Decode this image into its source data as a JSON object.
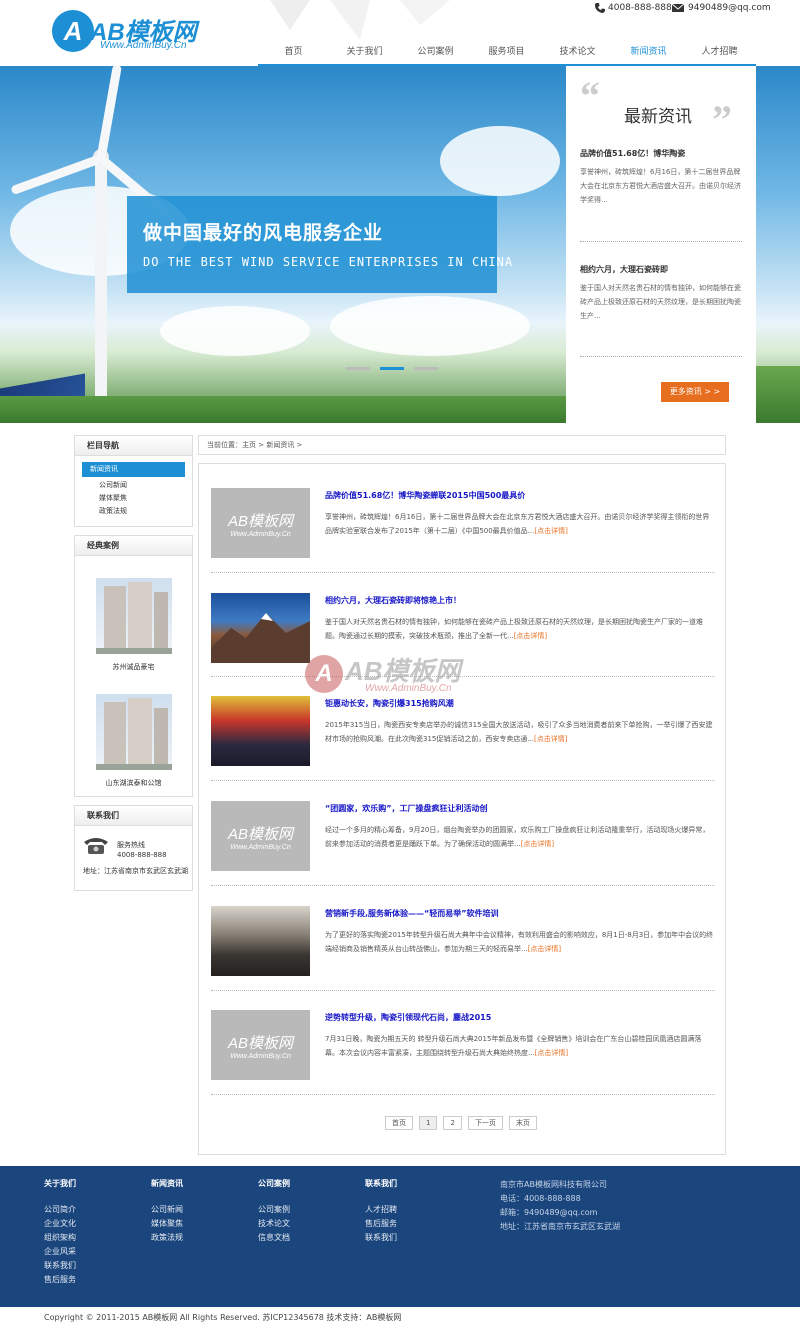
{
  "header": {
    "logo_text": "AB模板网",
    "logo_sub": "Www.AdminBuy.Cn",
    "phone": "4008-888-888",
    "email": "9490489@qq.com"
  },
  "nav": [
    {
      "label": "首页",
      "active": false
    },
    {
      "label": "关于我们",
      "active": false
    },
    {
      "label": "公司案例",
      "active": false
    },
    {
      "label": "服务项目",
      "active": false
    },
    {
      "label": "技术论文",
      "active": false
    },
    {
      "label": "新闻资讯",
      "active": true
    },
    {
      "label": "人才招聘",
      "active": false
    }
  ],
  "hero": {
    "title": "做中国最好的风电服务企业",
    "subtitle": "DO THE BEST WIND SERVICE ENTERPRISES IN CHINA",
    "slides_total": 3,
    "slide_current": 2
  },
  "news_panel": {
    "title": "最新资讯",
    "items": [
      {
        "head": "品牌价值51.68亿！博华陶瓷",
        "text": "享誉神州，砖筑辉煌！6月16日，第十二届世界品牌大会在北京东方君悦大酒店盛大召开。由诺贝尔经济学奖得..."
      },
      {
        "head": "相约六月，大理石瓷砖即",
        "text": "鉴于国人对天然名贵石材的情有独钟，如何能够在瓷砖产品上极致还原石材的天然纹理，是长期困扰陶瓷生产..."
      }
    ],
    "more_label": "更多资讯 > >"
  },
  "sidebar": {
    "nav_title": "栏目导航",
    "nav_active": "新闻资讯",
    "nav_links": [
      "公司新闻",
      "媒体聚焦",
      "政策法规"
    ],
    "cases_title": "经典案例",
    "cases": [
      "苏州诚品豪宅",
      "山东湖滨泰和公馆"
    ],
    "contact_title": "联系我们",
    "hotline_label": "服务热线",
    "hotline": "4008-888-888",
    "address": "地址：江苏省南京市玄武区玄武湖"
  },
  "breadcrumb": "当前位置：主页 > 新闻资讯 >",
  "articles": [
    {
      "title": "品牌价值51.68亿！博华陶瓷蝉联2015中国500最具价",
      "text": "享誉神州，砖筑辉煌！6月16日，第十二届世界品牌大会在北京东方君悦大酒店盛大召开。由诺贝尔经济学奖得主领衔的世界品牌实验室联合发布了2015年（第十二届）《中国500最具价值品...",
      "more": "[点击详情]",
      "thumb": "placeholder"
    },
    {
      "title": "相约六月，大理石瓷砖即将惊艳上市！",
      "text": "鉴于国人对天然名贵石材的情有独钟，如何能够在瓷砖产品上极致还原石材的天然纹理，是长期困扰陶瓷生产厂家的一道难题。陶瓷通过长期的摸索，突破技术瓶颈，推出了全新一代...",
      "more": "[点击详情]",
      "thumb": "mountain"
    },
    {
      "title": "钜惠动长安，陶瓷引爆315抢购风潮",
      "text": "2015年315当日，陶瓷西安专卖店举办的诚信315全国大放送活动，吸引了众多当地消费者前来下单抢购，一举引爆了西安建材市场的抢购风潮。在此次陶瓷315促销活动之前，西安专卖店通...",
      "more": "[点击详情]",
      "thumb": "crowd"
    },
    {
      "title": "“团圆家，欢乐购”，工厂操盘疯狂让利活动创",
      "text": "经过一个多月的精心筹备，9月20日，烟台陶瓷举办的团圆家，欢乐购工厂操盘疯狂让利活动隆重举行，活动现场火爆异常，前来参加活动的消费者更是踊跃下单。为了确保活动的圆满举...",
      "more": "[点击详情]",
      "thumb": "placeholder"
    },
    {
      "title": "营销新手段,服务新体验——“轻而易举”软件培训",
      "text": "为了更好的落实陶瓷2015年转型升级石尚大典年中会议精神，有效利用盛会的影响效应，8月1日-8月3日，参加年中会议的终端经销商及销售精英从台山转战佛山，参加为期三天的轻而易举...",
      "more": "[点击详情]",
      "thumb": "meeting"
    },
    {
      "title": "逆势转型升级，陶瓷引领现代石尚，鏖战2015",
      "text": "7月31日晚，陶瓷为期五天的 转型升级石尚大典2015年新品发布暨《全牌销售》培训会在广东台山碧桂园凤凰酒店圆满落幕。本次会议内容丰富紧凑，主题围绕转型升级石尚大典始终热度...",
      "more": "[点击详情]",
      "thumb": "placeholder"
    }
  ],
  "placeholder": {
    "big": "AB模板网",
    "small": "Www.AdminBuy.Cn"
  },
  "pager": [
    "首页",
    "1",
    "2",
    "下一页",
    "末页"
  ],
  "watermark": {
    "text": "AB模板网",
    "sub": "Www.AdminBuy.Cn"
  },
  "footer": {
    "cols": [
      {
        "head": "关于我们",
        "links": [
          "公司简介",
          "企业文化",
          "组织架构",
          "企业风采",
          "联系我们",
          "售后服务"
        ]
      },
      {
        "head": "新闻资讯",
        "links": [
          "公司新闻",
          "媒体聚焦",
          "政策法规"
        ]
      },
      {
        "head": "公司案例",
        "links": [
          "公司案例",
          "技术论文",
          "信息文档"
        ]
      },
      {
        "head": "联系我们",
        "links": [
          "人才招聘",
          "售后服务",
          "联系我们"
        ]
      }
    ],
    "info": [
      "南京市AB模板网科技有限公司",
      "电话：4008-888-888",
      "邮箱：9490489@qq.com",
      "地址：江苏省南京市玄武区玄武湖"
    ]
  },
  "copyright": "Copyright © 2011-2015 AB模板网 All Rights Reserved.    苏ICP12345678    技术支持：AB模板网",
  "colors": {
    "primary": "#1d8fd4",
    "accent": "#e86e1f",
    "footer": "#1a457d"
  }
}
